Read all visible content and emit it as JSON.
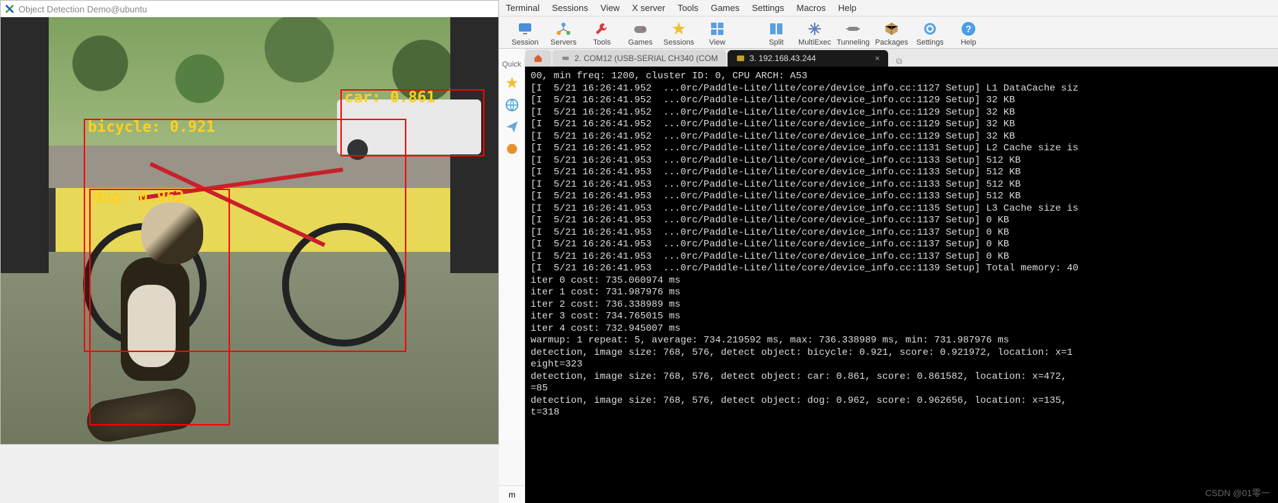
{
  "left_window": {
    "title": "Object Detection Demo@ubuntu"
  },
  "detections": {
    "car": {
      "label": "car: 0.861"
    },
    "bicycle": {
      "label": "bicycle: 0.921"
    },
    "dog": {
      "label": "dog: 0.962"
    }
  },
  "menubar": [
    "Terminal",
    "Sessions",
    "View",
    "X server",
    "Tools",
    "Games",
    "Settings",
    "Macros",
    "Help"
  ],
  "toolbar": [
    {
      "label": "Session",
      "icon": "monitor"
    },
    {
      "label": "Servers",
      "icon": "network"
    },
    {
      "label": "Tools",
      "icon": "wrench"
    },
    {
      "label": "Games",
      "icon": "gamepad"
    },
    {
      "label": "Sessions",
      "icon": "star"
    },
    {
      "label": "View",
      "icon": "grid"
    },
    {
      "label": "Split",
      "icon": "split",
      "gap": true
    },
    {
      "label": "MultiExec",
      "icon": "multi"
    },
    {
      "label": "Tunneling",
      "icon": "tunnel"
    },
    {
      "label": "Packages",
      "icon": "package"
    },
    {
      "label": "Settings",
      "icon": "gear"
    },
    {
      "label": "Help",
      "icon": "help"
    }
  ],
  "sidebar_quick": "Quick",
  "tabs": {
    "inactive": {
      "label": "2. COM12  (USB-SERIAL CH340 (COM",
      "icon": "serial"
    },
    "active": {
      "label": "3. 192.168.43.244",
      "icon": "ssh"
    }
  },
  "terminal_lines": [
    "00, min freq: 1200, cluster ID: 0, CPU ARCH: A53",
    "[I  5/21 16:26:41.952  ...0rc/Paddle-Lite/lite/core/device_info.cc:1127 Setup] L1 DataCache siz",
    "[I  5/21 16:26:41.952  ...0rc/Paddle-Lite/lite/core/device_info.cc:1129 Setup] 32 KB",
    "[I  5/21 16:26:41.952  ...0rc/Paddle-Lite/lite/core/device_info.cc:1129 Setup] 32 KB",
    "[I  5/21 16:26:41.952  ...0rc/Paddle-Lite/lite/core/device_info.cc:1129 Setup] 32 KB",
    "[I  5/21 16:26:41.952  ...0rc/Paddle-Lite/lite/core/device_info.cc:1129 Setup] 32 KB",
    "[I  5/21 16:26:41.952  ...0rc/Paddle-Lite/lite/core/device_info.cc:1131 Setup] L2 Cache size is",
    "[I  5/21 16:26:41.953  ...0rc/Paddle-Lite/lite/core/device_info.cc:1133 Setup] 512 KB",
    "[I  5/21 16:26:41.953  ...0rc/Paddle-Lite/lite/core/device_info.cc:1133 Setup] 512 KB",
    "[I  5/21 16:26:41.953  ...0rc/Paddle-Lite/lite/core/device_info.cc:1133 Setup] 512 KB",
    "[I  5/21 16:26:41.953  ...0rc/Paddle-Lite/lite/core/device_info.cc:1133 Setup] 512 KB",
    "[I  5/21 16:26:41.953  ...0rc/Paddle-Lite/lite/core/device_info.cc:1135 Setup] L3 Cache size is",
    "[I  5/21 16:26:41.953  ...0rc/Paddle-Lite/lite/core/device_info.cc:1137 Setup] 0 KB",
    "[I  5/21 16:26:41.953  ...0rc/Paddle-Lite/lite/core/device_info.cc:1137 Setup] 0 KB",
    "[I  5/21 16:26:41.953  ...0rc/Paddle-Lite/lite/core/device_info.cc:1137 Setup] 0 KB",
    "[I  5/21 16:26:41.953  ...0rc/Paddle-Lite/lite/core/device_info.cc:1137 Setup] 0 KB",
    "[I  5/21 16:26:41.953  ...0rc/Paddle-Lite/lite/core/device_info.cc:1139 Setup] Total memory: 40",
    "iter 0 cost: 735.060974 ms",
    "iter 1 cost: 731.987976 ms",
    "iter 2 cost: 736.338989 ms",
    "iter 3 cost: 734.765015 ms",
    "iter 4 cost: 732.945007 ms",
    "warmup: 1 repeat: 5, average: 734.219592 ms, max: 736.338989 ms, min: 731.987976 ms",
    "detection, image size: 768, 576, detect object: bicycle: 0.921, score: 0.921972, location: x=1",
    "eight=323",
    "detection, image size: 768, 576, detect object: car: 0.861, score: 0.861582, location: x=472, ",
    "=85",
    "detection, image size: 768, 576, detect object: dog: 0.962, score: 0.962656, location: x=135, ",
    "t=318"
  ],
  "watermark": "CSDN @01零一",
  "bottom_char": "m"
}
